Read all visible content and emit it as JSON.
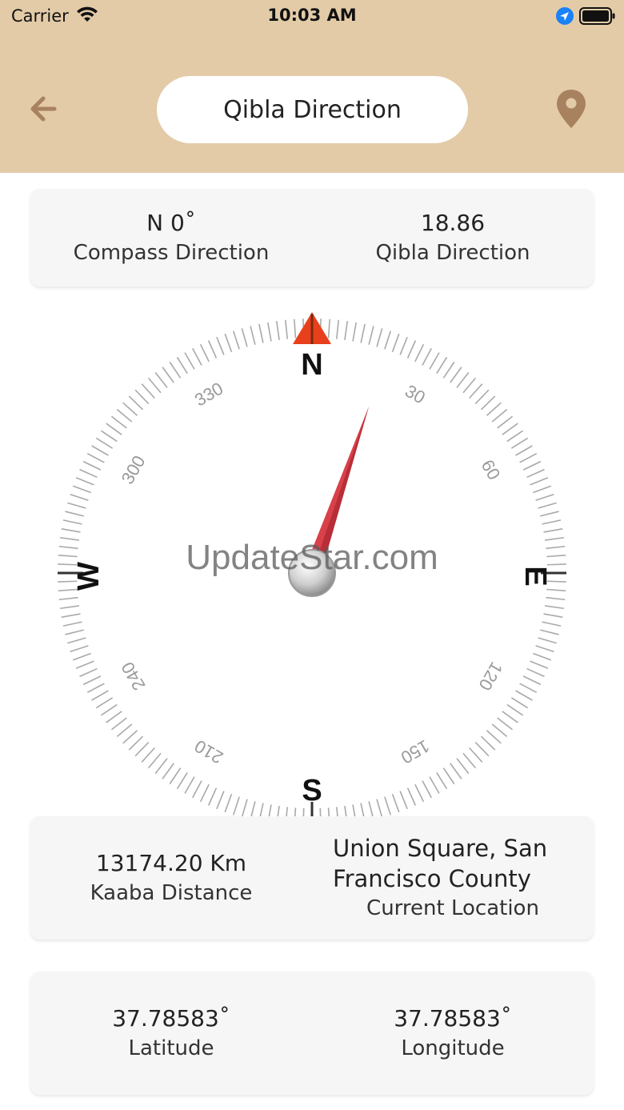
{
  "status_bar": {
    "carrier": "Carrier",
    "time": "10:03 AM"
  },
  "header": {
    "title": "Qibla Direction",
    "back_icon": "arrow-left-icon",
    "location_icon": "map-pin-icon"
  },
  "direction_card": {
    "compass_value": "N 0˚",
    "compass_label": "Compass Direction",
    "qibla_value": "18.86",
    "qibla_label": "Qibla Direction"
  },
  "compass": {
    "cardinals": {
      "n": "N",
      "e": "E",
      "s": "S",
      "w": "W"
    },
    "degree_labels": [
      "30",
      "60",
      "120",
      "150",
      "210",
      "240",
      "300",
      "330"
    ],
    "needle_bearing_deg": 18.86,
    "north_marker_color": "#e8401c",
    "needle_color": "#d9414a"
  },
  "watermark": "UpdateStar.com",
  "distance_card": {
    "distance_value": "13174.20 Km",
    "distance_label": "Kaaba Distance",
    "location_value": "Union Square, San Francisco County",
    "location_label": "Current Location"
  },
  "coords_card": {
    "latitude_value": "37.78583˚",
    "latitude_label": "Latitude",
    "longitude_value": "37.78583˚",
    "longitude_label": "Longitude"
  },
  "colors": {
    "header_bg": "#e3cba8",
    "accent_brown": "#a8825f",
    "card_bg": "#f6f6f6"
  }
}
